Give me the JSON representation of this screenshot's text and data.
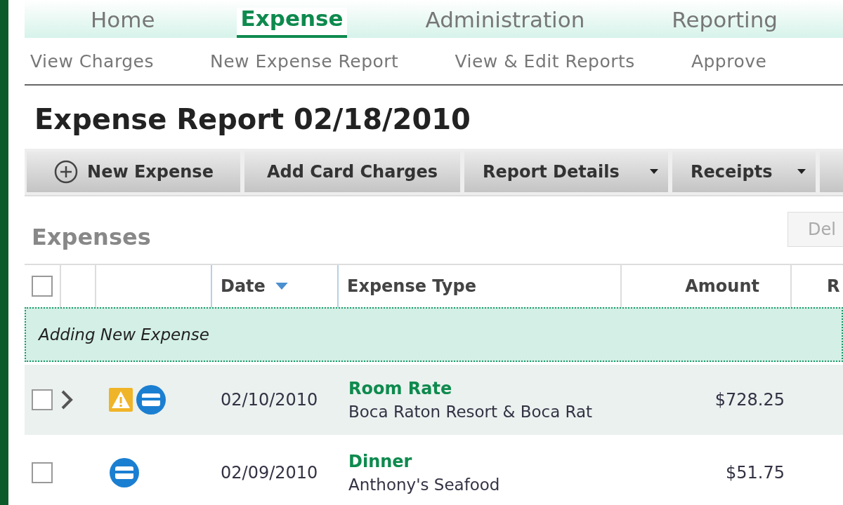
{
  "main_tabs": [
    {
      "label": "Home",
      "selected": false
    },
    {
      "label": "Expense",
      "selected": true
    },
    {
      "label": "Administration",
      "selected": false
    },
    {
      "label": "Reporting",
      "selected": false
    }
  ],
  "sub_nav": [
    "View Charges",
    "New Expense Report",
    "View & Edit Reports",
    "Approve"
  ],
  "title": "Expense Report 02/18/2010",
  "toolbar": [
    {
      "label": "New Expense",
      "kind": "add"
    },
    {
      "label": "Add Card Charges",
      "kind": "plain"
    },
    {
      "label": "Report Details",
      "kind": "menu"
    },
    {
      "label": "Receipts",
      "kind": "menu"
    },
    {
      "kind": "stub"
    }
  ],
  "expenses": {
    "heading": "Expenses",
    "delete_button": "Del",
    "header_checkbox": {
      "checked": false
    },
    "columns": [
      {
        "label": "Date",
        "sorted": true
      },
      {
        "label": "Expense Type",
        "sorted": false
      },
      {
        "label": "Amount",
        "sorted": false
      },
      {
        "label": "R",
        "sorted": false
      }
    ],
    "adding_row": "Adding New Expense",
    "rows": [
      {
        "checked": false,
        "expandable": true,
        "icons": [
          {
            "kind": "warning"
          },
          {
            "kind": "card"
          }
        ],
        "date": "02/10/2010",
        "type": "Room Rate",
        "vendor": "Boca Raton Resort & Boca Rat",
        "amount": "$728.25",
        "selected": true
      },
      {
        "checked": false,
        "expandable": false,
        "icons": [
          {
            "kind": "card"
          }
        ],
        "date": "02/09/2010",
        "type": "Dinner",
        "vendor": "Anthony's Seafood",
        "amount": "$51.75",
        "selected": false
      }
    ]
  }
}
